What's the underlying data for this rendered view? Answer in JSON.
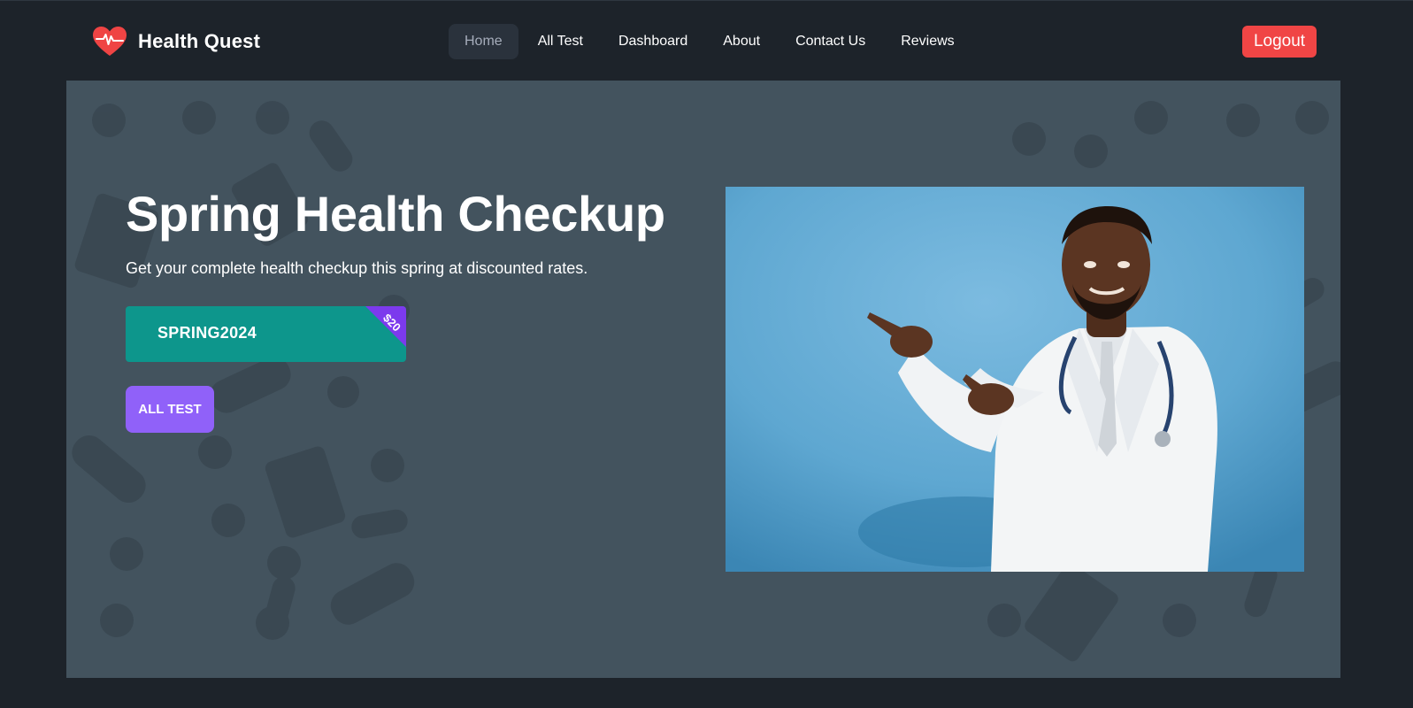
{
  "brand": {
    "name": "Health Quest",
    "logo_icon": "heart-pulse-icon",
    "logo_color": "#ef4444"
  },
  "nav": {
    "items": [
      {
        "label": "Home",
        "active": true
      },
      {
        "label": "All Test",
        "active": false
      },
      {
        "label": "Dashboard",
        "active": false
      },
      {
        "label": "About",
        "active": false
      },
      {
        "label": "Contact Us",
        "active": false
      },
      {
        "label": "Reviews",
        "active": false
      }
    ],
    "logout_label": "Logout"
  },
  "hero": {
    "title": "Spring Health Checkup",
    "subtitle": "Get your complete health checkup this spring at discounted rates.",
    "coupon": {
      "code": "SPRING2024",
      "discount": "$20"
    },
    "cta_label": "ALL TEST",
    "image_icon": "doctor-pointing-photo"
  },
  "colors": {
    "page_bg": "#1d232a",
    "hero_bg": "#43535e",
    "logout": "#f04545",
    "coupon": "#0d968c",
    "ribbon": "#7c3aed",
    "cta": "#9061f9"
  }
}
